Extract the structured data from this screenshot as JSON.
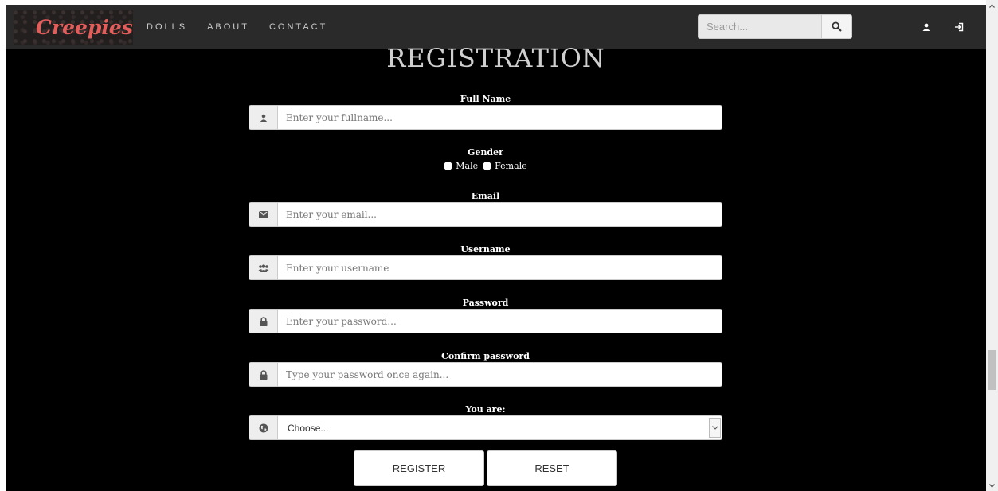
{
  "navbar": {
    "brand": "Creepies",
    "links": [
      {
        "label": "DOLLS"
      },
      {
        "label": "ABOUT"
      },
      {
        "label": "CONTACT"
      }
    ],
    "search": {
      "placeholder": "Search...",
      "value": ""
    },
    "icons": [
      "search-icon",
      "user-icon",
      "login-icon"
    ]
  },
  "form": {
    "title": "REGISTRATION",
    "full_name": {
      "label": "Full Name",
      "placeholder": "Enter your fullname...",
      "icon": "user-icon"
    },
    "gender": {
      "label": "Gender",
      "options": [
        "Male",
        "Female"
      ]
    },
    "email": {
      "label": "Email",
      "placeholder": "Enter your email...",
      "icon": "envelope-icon"
    },
    "username": {
      "label": "Username",
      "placeholder": "Enter your username",
      "icon": "users-icon"
    },
    "password": {
      "label": "Password",
      "placeholder": "Enter your password...",
      "icon": "lock-icon"
    },
    "confirm_password": {
      "label": "Confirm password",
      "placeholder": "Type your password once again...",
      "icon": "lock-icon"
    },
    "you_are": {
      "label": "You are:",
      "selected": "Choose...",
      "icon": "globe-icon"
    },
    "buttons": {
      "register": "REGISTER",
      "reset": "RESET"
    }
  },
  "colors": {
    "brand": "#e35d5b",
    "navbar_bg": "#2a2a2a",
    "page_bg": "#000000",
    "title": "#cfcfcf"
  }
}
